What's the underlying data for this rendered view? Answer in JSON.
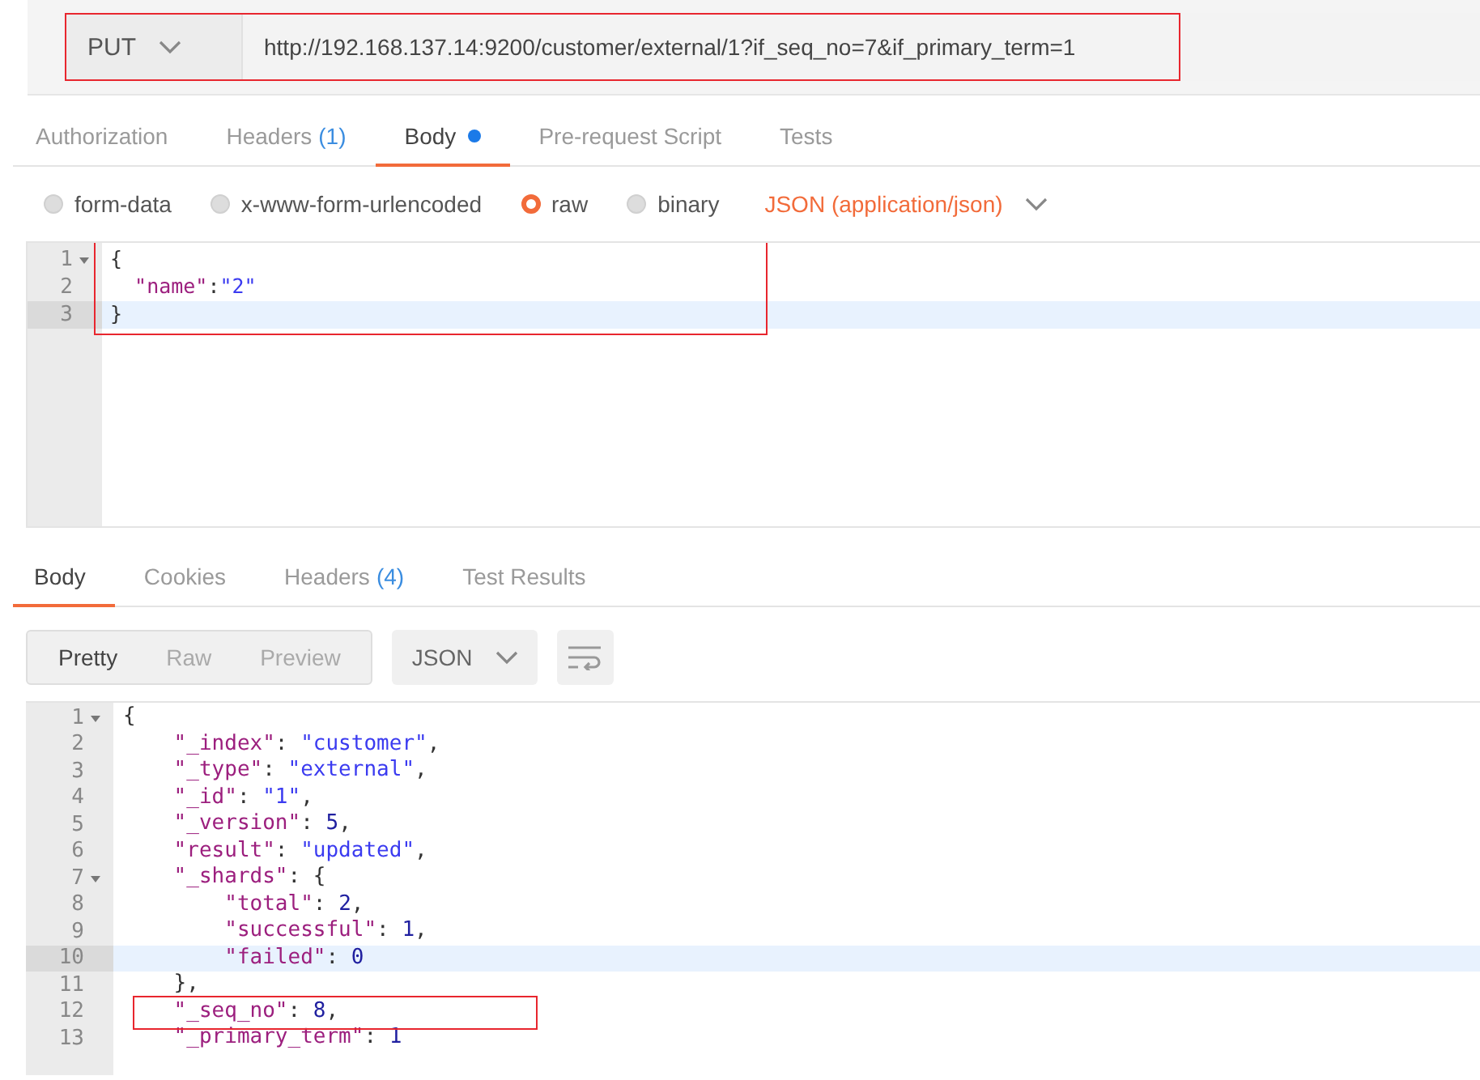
{
  "request": {
    "method": "PUT",
    "url": "http://192.168.137.14:9200/customer/external/1?if_seq_no=7&if_primary_term=1",
    "annotated": true
  },
  "request_tabs": [
    {
      "label": "Authorization",
      "selected": false,
      "dot": false
    },
    {
      "label": "Headers",
      "count": "(1)",
      "selected": false,
      "dot": false
    },
    {
      "label": "Body",
      "selected": true,
      "dot": true
    },
    {
      "label": "Pre-request Script",
      "selected": false,
      "dot": false
    },
    {
      "label": "Tests",
      "selected": false,
      "dot": false
    }
  ],
  "body_modes": [
    {
      "label": "form-data",
      "selected": false
    },
    {
      "label": "x-www-form-urlencoded",
      "selected": false
    },
    {
      "label": "raw",
      "selected": true
    },
    {
      "label": "binary",
      "selected": false
    }
  ],
  "content_type": "JSON (application/json)",
  "request_editor": {
    "annotated": true,
    "lines": [
      {
        "number": "1",
        "fold": true,
        "current": false,
        "tokens": [
          {
            "kind": "punct",
            "text": "{"
          }
        ]
      },
      {
        "number": "2",
        "fold": false,
        "current": false,
        "tokens": [
          {
            "kind": "key",
            "text": "  \"name\""
          },
          {
            "kind": "punct",
            "text": ":"
          },
          {
            "kind": "string",
            "text": "\"2\""
          }
        ]
      },
      {
        "number": "3",
        "fold": false,
        "current": true,
        "tokens": [
          {
            "kind": "punct",
            "text": "}"
          }
        ]
      }
    ]
  },
  "response_tabs": [
    {
      "label": "Body",
      "selected": true
    },
    {
      "label": "Cookies",
      "selected": false
    },
    {
      "label": "Headers",
      "count": "(4)",
      "selected": false
    },
    {
      "label": "Test Results",
      "selected": false
    }
  ],
  "views": [
    {
      "label": "Pretty",
      "selected": true
    },
    {
      "label": "Raw",
      "selected": false
    },
    {
      "label": "Preview",
      "selected": false
    }
  ],
  "format": "JSON",
  "response_editor": {
    "lines": [
      {
        "number": "1",
        "fold": true,
        "current": false,
        "annotated": false,
        "tokens": [
          {
            "kind": "punct",
            "text": "{"
          }
        ]
      },
      {
        "number": "2",
        "fold": false,
        "current": false,
        "annotated": false,
        "tokens": [
          {
            "kind": "key",
            "text": "    \"_index\""
          },
          {
            "kind": "punct",
            "text": ": "
          },
          {
            "kind": "string",
            "text": "\"customer\""
          },
          {
            "kind": "punct",
            "text": ","
          }
        ]
      },
      {
        "number": "3",
        "fold": false,
        "current": false,
        "annotated": false,
        "tokens": [
          {
            "kind": "key",
            "text": "    \"_type\""
          },
          {
            "kind": "punct",
            "text": ": "
          },
          {
            "kind": "string",
            "text": "\"external\""
          },
          {
            "kind": "punct",
            "text": ","
          }
        ]
      },
      {
        "number": "4",
        "fold": false,
        "current": false,
        "annotated": false,
        "tokens": [
          {
            "kind": "key",
            "text": "    \"_id\""
          },
          {
            "kind": "punct",
            "text": ": "
          },
          {
            "kind": "string",
            "text": "\"1\""
          },
          {
            "kind": "punct",
            "text": ","
          }
        ]
      },
      {
        "number": "5",
        "fold": false,
        "current": false,
        "annotated": false,
        "tokens": [
          {
            "kind": "key",
            "text": "    \"_version\""
          },
          {
            "kind": "punct",
            "text": ": "
          },
          {
            "kind": "number",
            "text": "5"
          },
          {
            "kind": "punct",
            "text": ","
          }
        ]
      },
      {
        "number": "6",
        "fold": false,
        "current": false,
        "annotated": false,
        "tokens": [
          {
            "kind": "key",
            "text": "    \"result\""
          },
          {
            "kind": "punct",
            "text": ": "
          },
          {
            "kind": "string",
            "text": "\"updated\""
          },
          {
            "kind": "punct",
            "text": ","
          }
        ]
      },
      {
        "number": "7",
        "fold": true,
        "current": false,
        "annotated": false,
        "tokens": [
          {
            "kind": "key",
            "text": "    \"_shards\""
          },
          {
            "kind": "punct",
            "text": ": {"
          }
        ]
      },
      {
        "number": "8",
        "fold": false,
        "current": false,
        "annotated": false,
        "tokens": [
          {
            "kind": "key",
            "text": "        \"total\""
          },
          {
            "kind": "punct",
            "text": ": "
          },
          {
            "kind": "number",
            "text": "2"
          },
          {
            "kind": "punct",
            "text": ","
          }
        ]
      },
      {
        "number": "9",
        "fold": false,
        "current": false,
        "annotated": false,
        "tokens": [
          {
            "kind": "key",
            "text": "        \"successful\""
          },
          {
            "kind": "punct",
            "text": ": "
          },
          {
            "kind": "number",
            "text": "1"
          },
          {
            "kind": "punct",
            "text": ","
          }
        ]
      },
      {
        "number": "10",
        "fold": false,
        "current": true,
        "annotated": false,
        "tokens": [
          {
            "kind": "key",
            "text": "        \"failed\""
          },
          {
            "kind": "punct",
            "text": ": "
          },
          {
            "kind": "number",
            "text": "0"
          }
        ]
      },
      {
        "number": "11",
        "fold": false,
        "current": false,
        "annotated": false,
        "tokens": [
          {
            "kind": "punct",
            "text": "    },"
          }
        ]
      },
      {
        "number": "12",
        "fold": false,
        "current": false,
        "annotated": true,
        "tokens": [
          {
            "kind": "key",
            "text": "    \"_seq_no\""
          },
          {
            "kind": "punct",
            "text": ": "
          },
          {
            "kind": "number",
            "text": "8"
          },
          {
            "kind": "punct",
            "text": ","
          }
        ]
      },
      {
        "number": "13",
        "fold": false,
        "current": false,
        "annotated": false,
        "tokens": [
          {
            "kind": "key",
            "text": "    \"_primary_term\""
          },
          {
            "kind": "punct",
            "text": ": "
          },
          {
            "kind": "number",
            "text": "1"
          }
        ]
      }
    ]
  }
}
